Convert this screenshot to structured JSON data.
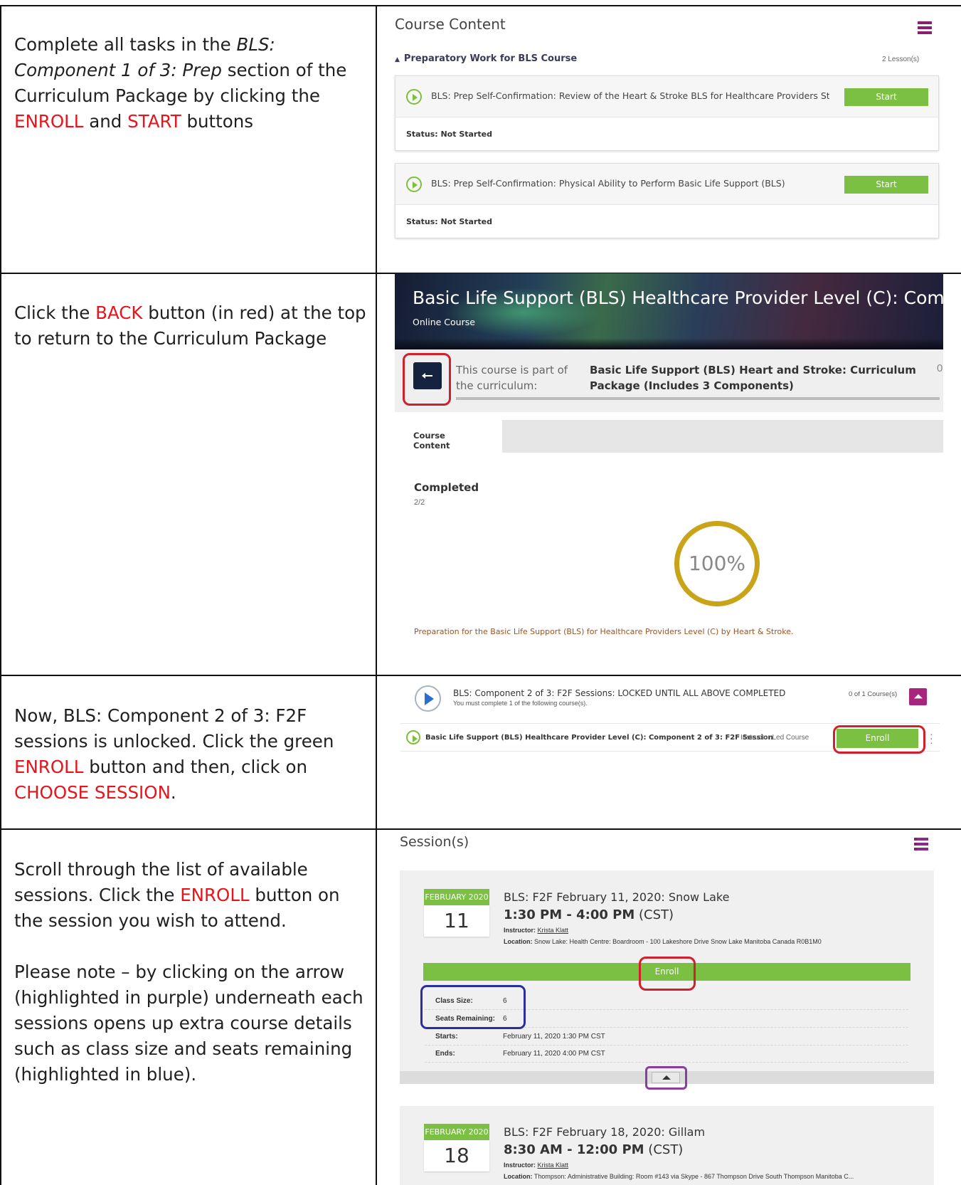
{
  "rows": [
    {
      "instruction": {
        "p1_a": "Complete all tasks in the ",
        "p1_italic": "BLS: Component 1 of 3: Prep",
        "p1_b": " section of the Curriculum Package by clicking the ",
        "p1_red1": "ENROLL",
        "p1_c": " and ",
        "p1_red2": "START",
        "p1_d": " buttons"
      }
    },
    {
      "instruction": {
        "p1_a": "Click the ",
        "p1_red1": "BACK",
        "p1_b": " button (in red) at the top to return to the Curriculum Package"
      }
    },
    {
      "instruction": {
        "p1_a": "Now, BLS: Component 2 of 3: F2F sessions is unlocked. Click the green ",
        "p1_red1": "ENROLL",
        "p1_b": " button and then, click on ",
        "p1_red2": "CHOOSE SESSION",
        "p1_c": "."
      }
    },
    {
      "instruction": {
        "p1_a": "Scroll through the list of available sessions. Click the ",
        "p1_red1": "ENROLL",
        "p1_b": " button on the session you wish to attend.",
        "p2": "Please note – by clicking on the arrow (highlighted in purple) underneath each sessions opens up extra course details such as class size and seats remaining (highlighted in blue)."
      }
    }
  ],
  "course_content": {
    "title": "Course Content",
    "section_title": "Preparatory Work for BLS Course",
    "lesson_count": "2 Lesson(s)",
    "lessons": [
      {
        "name": "BLS: Prep Self-Confirmation: Review of the Heart & Stroke BLS for Healthcare Providers Student Manual",
        "button": "Start",
        "status": "Status: Not Started"
      },
      {
        "name": "BLS: Prep Self-Confirmation: Physical Ability to Perform Basic Life Support (BLS)",
        "button": "Start",
        "status": "Status: Not Started"
      }
    ]
  },
  "course_detail": {
    "banner_title": "Basic Life Support (BLS) Healthcare Provider Level (C): Com...",
    "banner_subtitle": "Online Course",
    "curriculum_label": "This course is part of the curriculum:",
    "curriculum_name": "Basic Life Support (BLS) Heart and Stroke: Curriculum Package (Includes 3 Components)",
    "curriculum_trailing": "0",
    "tab": "Course Content",
    "completed_label": "Completed",
    "completed_count": "2/2",
    "progress_text": "100%",
    "progress_value": 1.0,
    "description": "Preparation for the Basic Life Support (BLS) for Healthcare Providers Level (C) by Heart & Stroke."
  },
  "component2": {
    "title": "BLS: Component 2 of 3: F2F Sessions: LOCKED UNTIL ALL ABOVE COMPLETED",
    "subtitle": "You must complete 1 of the following course(s).",
    "count": "0 of 1 Course(s)",
    "course_name": "Basic Life Support (BLS) Healthcare Provider Level (C): Component 2 of 3: F2F Session",
    "course_type": "Instructor Led Course",
    "enroll": "Enroll"
  },
  "sessions": {
    "title": "Session(s)",
    "items": [
      {
        "month": "FEBRUARY 2020",
        "day": "11",
        "name": "BLS: F2F February 11, 2020: Snow Lake",
        "time": "1:30 PM - 4:00 PM",
        "tz": "(CST)",
        "instructor_label": "Instructor:",
        "instructor": "Krista Klatt",
        "location_label": "Location:",
        "location": "Snow Lake: Health Centre: Boardroom - 100 Lakeshore Drive Snow Lake Manitoba Canada R0B1M0",
        "enroll": "Enroll",
        "details": [
          {
            "k": "Class Size:",
            "v": "6"
          },
          {
            "k": "Seats Remaining:",
            "v": "6"
          },
          {
            "k": "Starts:",
            "v": "February 11, 2020 1:30 PM CST"
          },
          {
            "k": "Ends:",
            "v": "February 11, 2020 4:00 PM CST"
          }
        ]
      },
      {
        "month": "FEBRUARY 2020",
        "day": "18",
        "name": "BLS: F2F February 18, 2020: Gillam",
        "time": "8:30 AM - 12:00 PM",
        "tz": "(CST)",
        "instructor_label": "Instructor:",
        "instructor": "Krista Klatt",
        "location_label": "Location:",
        "location": "Thompson: Administrative Building: Room #143 via Skype - 867 Thompson Drive South Thompson Manitoba C..."
      }
    ]
  },
  "colors": {
    "accent_red": "#e8141b",
    "green": "#7bc043",
    "navy": "#152340",
    "purple": "#a8257e",
    "gold": "#c9a318"
  }
}
